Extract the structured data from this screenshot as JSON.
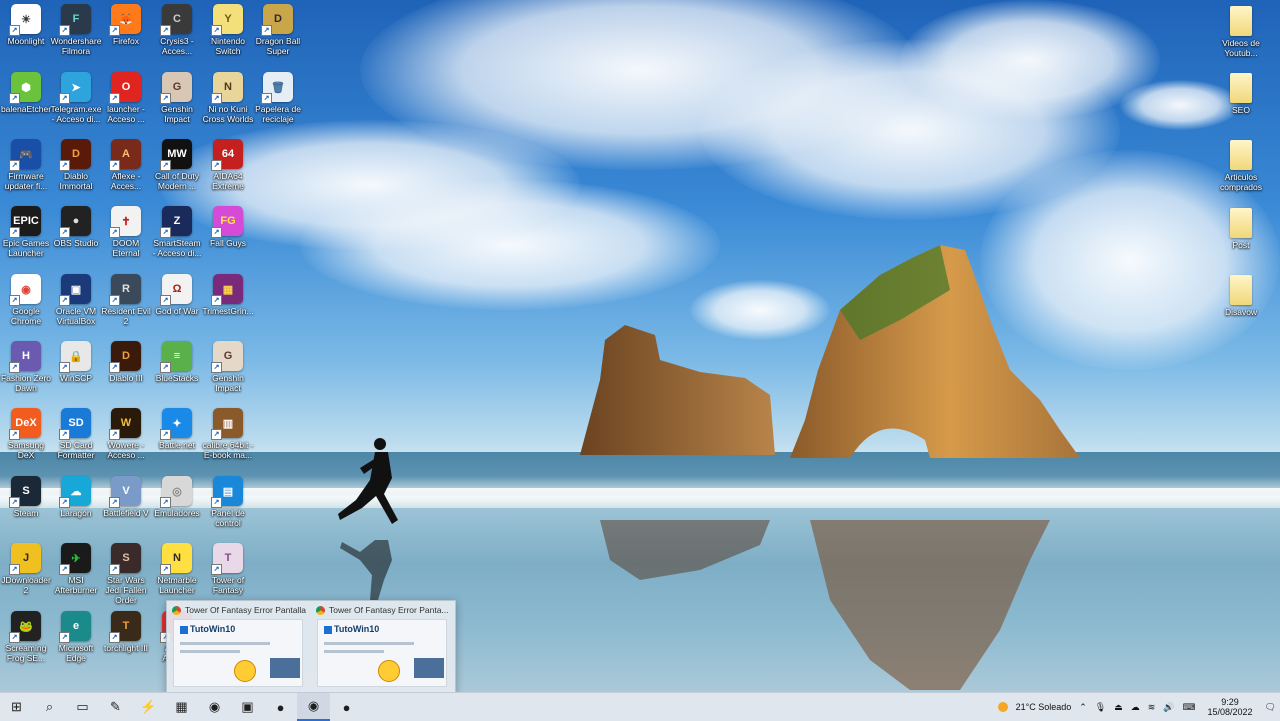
{
  "desktop_icons": [
    {
      "label": "Moonlight",
      "glyph": "☀",
      "color": "#ffffff",
      "fg": "#333333"
    },
    {
      "label": "Wondershare Filmora",
      "glyph": "F",
      "color": "#2a3a4a",
      "fg": "#66d8c8"
    },
    {
      "label": "Firefox",
      "glyph": "🦊",
      "color": "#ff7a1a",
      "fg": "#ffffff"
    },
    {
      "label": "Crysis3 - Acces...",
      "glyph": "C",
      "color": "#3a3a3a",
      "fg": "#cccccc"
    },
    {
      "label": "Nintendo Switch",
      "glyph": "Y",
      "color": "#f3e07a",
      "fg": "#6a5a10"
    },
    {
      "label": "Dragon Ball Super",
      "glyph": "D",
      "color": "#c9a64a",
      "fg": "#2a2a2a"
    },
    {
      "label": "balenaEtcher",
      "glyph": "⬢",
      "color": "#6ac33a",
      "fg": "#ffffff"
    },
    {
      "label": "Telegram.exe - Acceso di...",
      "glyph": "➤",
      "color": "#2ea4dd",
      "fg": "#ffffff"
    },
    {
      "label": "launcher - Acceso ...",
      "glyph": "O",
      "color": "#e0241f",
      "fg": "#ffffff"
    },
    {
      "label": "Genshin Impact",
      "glyph": "G",
      "color": "#d9c7b5",
      "fg": "#5a3a2a"
    },
    {
      "label": "Ni no Kuni Cross Worlds",
      "glyph": "N",
      "color": "#e8d59a",
      "fg": "#4a3a1a"
    },
    {
      "label": "Papelera de reciclaje",
      "glyph": "🗑",
      "color": "#e6eef5",
      "fg": "#3a6a9a"
    },
    {
      "label": "Firmware updater fi...",
      "glyph": "🎮",
      "color": "#1a4fa8",
      "fg": "#ffffff"
    },
    {
      "label": "Diablo Immortal",
      "glyph": "D",
      "color": "#5a1a0a",
      "fg": "#f0a040"
    },
    {
      "label": "Aflexe - Acces...",
      "glyph": "A",
      "color": "#7a2a1a",
      "fg": "#f7c070"
    },
    {
      "label": "Call of Duty Modern ...",
      "glyph": "MW",
      "color": "#111111",
      "fg": "#ffffff"
    },
    {
      "label": "AIDA64 Extreme",
      "glyph": "64",
      "color": "#c42020",
      "fg": "#ffffff"
    },
    {
      "label": "Epic Games Launcher",
      "glyph": "EPIC",
      "color": "#1b1b1b",
      "fg": "#ffffff"
    },
    {
      "label": "OBS Studio",
      "glyph": "●",
      "color": "#222222",
      "fg": "#dddddd"
    },
    {
      "label": "DOOM Eternal",
      "glyph": "✝",
      "color": "#f2f2f2",
      "fg": "#c41e1e"
    },
    {
      "label": "SmartSteam - Acceso di...",
      "glyph": "Z",
      "color": "#1a2a5a",
      "fg": "#ffffff"
    },
    {
      "label": "Fall Guys",
      "glyph": "FG",
      "color": "#d64ad8",
      "fg": "#ffe24a"
    },
    {
      "label": "Google Chrome",
      "glyph": "◉",
      "color": "#ffffff",
      "fg": "#db4437"
    },
    {
      "label": "Oracle VM VirtualBox",
      "glyph": "▣",
      "color": "#1a3a7a",
      "fg": "#ffffff"
    },
    {
      "label": "Resident Evil 2",
      "glyph": "R",
      "color": "#3a4a5a",
      "fg": "#e0e0e0"
    },
    {
      "label": "God of War",
      "glyph": "Ω",
      "color": "#f2f2f2",
      "fg": "#b01818"
    },
    {
      "label": "TrimestGrin...",
      "glyph": "▦",
      "color": "#7a2a7a",
      "fg": "#ffd24a"
    },
    {
      "label": "Fashion Zero Dawn",
      "glyph": "H",
      "color": "#6a5ab0",
      "fg": "#ffffff"
    },
    {
      "label": "WinSCP",
      "glyph": "🔒",
      "color": "#e8e8e8",
      "fg": "#2a8a2a"
    },
    {
      "label": "Diablo III",
      "glyph": "D",
      "color": "#3a1a0a",
      "fg": "#f0a040"
    },
    {
      "label": "BlueStacks",
      "glyph": "≡",
      "color": "#5ab04a",
      "fg": "#ffffff"
    },
    {
      "label": "Genshin Impact",
      "glyph": "G",
      "color": "#e6d8c8",
      "fg": "#5a3a2a"
    },
    {
      "label": "Samsung DeX",
      "glyph": "DeX",
      "color": "#f25c1f",
      "fg": "#ffffff"
    },
    {
      "label": "SD Card Formatter",
      "glyph": "SD",
      "color": "#1a7ad8",
      "fg": "#ffffff"
    },
    {
      "label": "Wowere - Acceso ...",
      "glyph": "W",
      "color": "#2a1a0a",
      "fg": "#f0c040"
    },
    {
      "label": "Battle.net",
      "glyph": "✦",
      "color": "#1a8ae8",
      "fg": "#ffffff"
    },
    {
      "label": "calibre 64bit - E-book ma...",
      "glyph": "▥",
      "color": "#8a5a2a",
      "fg": "#ffffff"
    },
    {
      "label": "Steam",
      "glyph": "S",
      "color": "#1b2838",
      "fg": "#ffffff"
    },
    {
      "label": "Laragon",
      "glyph": "☁",
      "color": "#18a8d8",
      "fg": "#ffffff"
    },
    {
      "label": "Battlefield V",
      "glyph": "V",
      "color": "#7a9ac8",
      "fg": "#ffffff"
    },
    {
      "label": "Emuladores",
      "glyph": "◎",
      "color": "#d8d8d8",
      "fg": "#888888"
    },
    {
      "label": "Panel de control",
      "glyph": "▤",
      "color": "#1a88d8",
      "fg": "#ffffff"
    },
    {
      "label": "JDownloader 2",
      "glyph": "J",
      "color": "#f0c020",
      "fg": "#2a2a2a"
    },
    {
      "label": "MSI Afterburner",
      "glyph": "✈",
      "color": "#1a1a1a",
      "fg": "#2ac040"
    },
    {
      "label": "Star Wars Jedi Fallen Order",
      "glyph": "S",
      "color": "#3a2a2a",
      "fg": "#e0c0a0"
    },
    {
      "label": "Netmarble Launcher",
      "glyph": "N",
      "color": "#ffe040",
      "fg": "#2a2a2a"
    },
    {
      "label": "Tower of Fantasy",
      "glyph": "T",
      "color": "#e8d8e8",
      "fg": "#8a4a8a"
    },
    {
      "label": "Screaming Frog SE...",
      "glyph": "🐸",
      "color": "#222222",
      "fg": "#7ad040"
    },
    {
      "label": "Microsoft Edge",
      "glyph": "e",
      "color": "#1a8a8a",
      "fg": "#ffffff"
    },
    {
      "label": "torchlight III",
      "glyph": "T",
      "color": "#3a2a1a",
      "fg": "#f0a040"
    },
    {
      "label": "Adobe Acrobat",
      "glyph": "A",
      "color": "#e03030",
      "fg": "#ffffff"
    }
  ],
  "right_icons": [
    {
      "label": "Videos de Youtub..."
    },
    {
      "label": "SEO"
    },
    {
      "label": "Articulos comprados"
    },
    {
      "label": "Post"
    },
    {
      "label": "Disavow"
    }
  ],
  "preview": {
    "items": [
      {
        "title": "Tower Of Fantasy Error Pantalla ...",
        "brand": "TutoWin10"
      },
      {
        "title": "Tower Of Fantasy Error Panta...",
        "brand": "TutoWin10"
      }
    ]
  },
  "taskbar": {
    "icons": [
      {
        "name": "start-button",
        "glyph": "⊞"
      },
      {
        "name": "search-button",
        "glyph": "⌕"
      },
      {
        "name": "task-view-button",
        "glyph": "▭"
      },
      {
        "name": "app-pin-1",
        "glyph": "✎"
      },
      {
        "name": "app-pin-2",
        "glyph": "⚡"
      },
      {
        "name": "app-pin-3",
        "glyph": "▦"
      },
      {
        "name": "chrome-pin",
        "glyph": "◉"
      },
      {
        "name": "app-pin-5",
        "glyph": "▣"
      },
      {
        "name": "app-pin-6",
        "glyph": "●"
      },
      {
        "name": "chrome-active",
        "glyph": "◉",
        "active": true
      },
      {
        "name": "obs-pin",
        "glyph": "●"
      }
    ],
    "weather": "21°C  Soleado",
    "time": "9:29",
    "date": "15/08/2022"
  }
}
